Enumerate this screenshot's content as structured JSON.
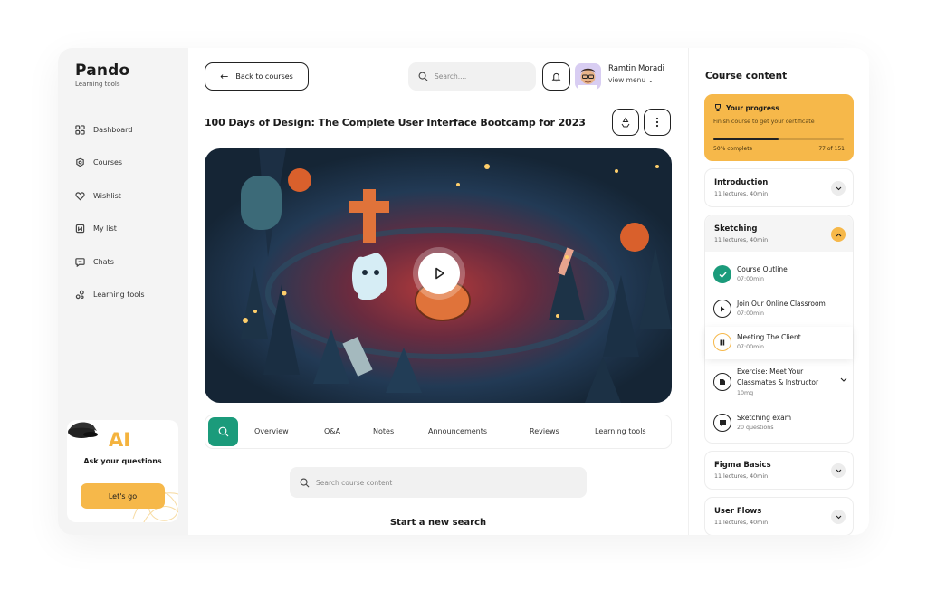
{
  "brand": {
    "name": "Pando",
    "subtitle": "Learning tools"
  },
  "sidebar": {
    "items": [
      {
        "label": "Dashboard",
        "icon": "dashboard-icon"
      },
      {
        "label": "Courses",
        "icon": "courses-icon"
      },
      {
        "label": "Wishlist",
        "icon": "heart-icon"
      },
      {
        "label": "My list",
        "icon": "bookmark-icon"
      },
      {
        "label": "Chats",
        "icon": "chat-icon"
      },
      {
        "label": "Learning tools",
        "icon": "tools-icon"
      }
    ]
  },
  "ai_card": {
    "title": "AI",
    "question": "Ask your questions",
    "button": "Let's go"
  },
  "header": {
    "back_label": "Back to courses",
    "search_placeholder": "Search....",
    "user_name": "Ramtin Moradi",
    "user_menu": "view menu"
  },
  "course": {
    "title": "100 Days of Design: The Complete User Interface Bootcamp for 2023"
  },
  "tabs": [
    "Overview",
    "Q&A",
    "Notes",
    "Announcements",
    "Reviews",
    "Learning tools"
  ],
  "course_search": {
    "placeholder": "Search course content",
    "empty_title": "Start a new search"
  },
  "panel": {
    "title": "Course content",
    "progress": {
      "title": "Your progress",
      "subtitle": "Finish course to get your certificate",
      "percent_label": "50% complete",
      "count_label": "77 of 151",
      "fraction": 0.5
    },
    "sections": [
      {
        "title": "Introduction",
        "meta": "11 lectures, 40min",
        "expanded": false
      },
      {
        "title": "Sketching",
        "meta": "11 lectures, 40min",
        "expanded": true,
        "lectures": [
          {
            "title": "Course Outline",
            "meta": "07:00min",
            "state": "done"
          },
          {
            "title": "Join Our Online Classroom!",
            "meta": "07:00min",
            "state": "play"
          },
          {
            "title": "Meeting The Client",
            "meta": "07:00min",
            "state": "paused"
          },
          {
            "title": "Exercise: Meet Your Classmates & Instructor",
            "meta": "10mg",
            "state": "exercise"
          },
          {
            "title": "Sketching exam",
            "meta": "20 questions",
            "state": "exam"
          }
        ]
      },
      {
        "title": "Figma Basics",
        "meta": "11 lectures, 40min",
        "expanded": false
      },
      {
        "title": "User Flows",
        "meta": "11 lectures, 40min",
        "expanded": false
      }
    ]
  },
  "colors": {
    "accent": "#f6b84a",
    "teal": "#1b9b7b",
    "done": "#1b9b7b"
  }
}
